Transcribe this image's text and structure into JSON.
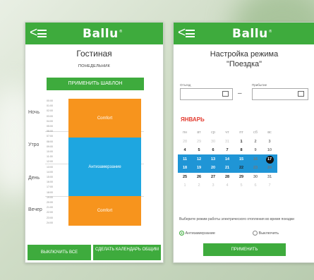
{
  "brand": {
    "logo": "Ballu",
    "logo_mark": "®",
    "green": "#3eab3d",
    "orange": "#f7941d",
    "blue": "#1ea6e0",
    "calendar_blue": "#1f95d6",
    "calendar_red": "#e33b2f"
  },
  "left_phone": {
    "room_title": "Гостиная",
    "day": "ПОНЕДЕЛЬНИК",
    "apply_template": "ПРИМЕНИТЬ ШАБЛОН",
    "periods": [
      "Ночь",
      "Утро",
      "День",
      "Вечер"
    ],
    "times": [
      "00:00",
      "01:00",
      "02:00",
      "03:00",
      "04:00",
      "05:00",
      "06:00",
      "07:00",
      "08:00",
      "09:00",
      "10:00",
      "11:00",
      "12:00",
      "13:00",
      "14:00",
      "15:00",
      "16:00",
      "17:00",
      "18:00",
      "19:00",
      "20:00",
      "21:00",
      "22:00",
      "23:00",
      "24:00"
    ],
    "blocks": [
      {
        "label": "Comfort",
        "color": "orange"
      },
      {
        "label": "Антизамерзание",
        "color": "blue"
      },
      {
        "label": "Comfort",
        "color": "orange"
      }
    ],
    "disable_all": "ВЫКЛЮЧИТЬ ВСЕ",
    "make_common": "СДЕЛАТЬ КАЛЕНДАРЬ ОБЩИМ"
  },
  "right_phone": {
    "title_line1": "Настройка режима",
    "title_line2": "\"Поездка\"",
    "departure_label": "Отъезд",
    "arrival_label": "Прибытие",
    "dash": "–",
    "month": "январь",
    "weekdays": [
      "пн",
      "вт",
      "ср",
      "чт",
      "пт",
      "сб",
      "вс"
    ],
    "weeks": [
      [
        "28",
        "29",
        "30",
        "31",
        "1",
        "2",
        "3"
      ],
      [
        "4",
        "5",
        "6",
        "7",
        "8",
        "9",
        "10"
      ],
      [
        "11",
        "12",
        "13",
        "14",
        "15",
        "16",
        "17"
      ],
      [
        "18",
        "19",
        "20",
        "21",
        "22",
        "23",
        "24"
      ],
      [
        "25",
        "26",
        "27",
        "28",
        "29",
        "30",
        "31"
      ],
      [
        "1",
        "2",
        "3",
        "4",
        "5",
        "6",
        "7"
      ]
    ],
    "mode_prompt": "Выберите режим работы электрического отопления во время поездки",
    "option_antifreeze": "Антизамерзание",
    "option_off": "Выключить",
    "selected_option": "Антизамерзание",
    "apply": "ПРИМЕНИТЬ"
  }
}
